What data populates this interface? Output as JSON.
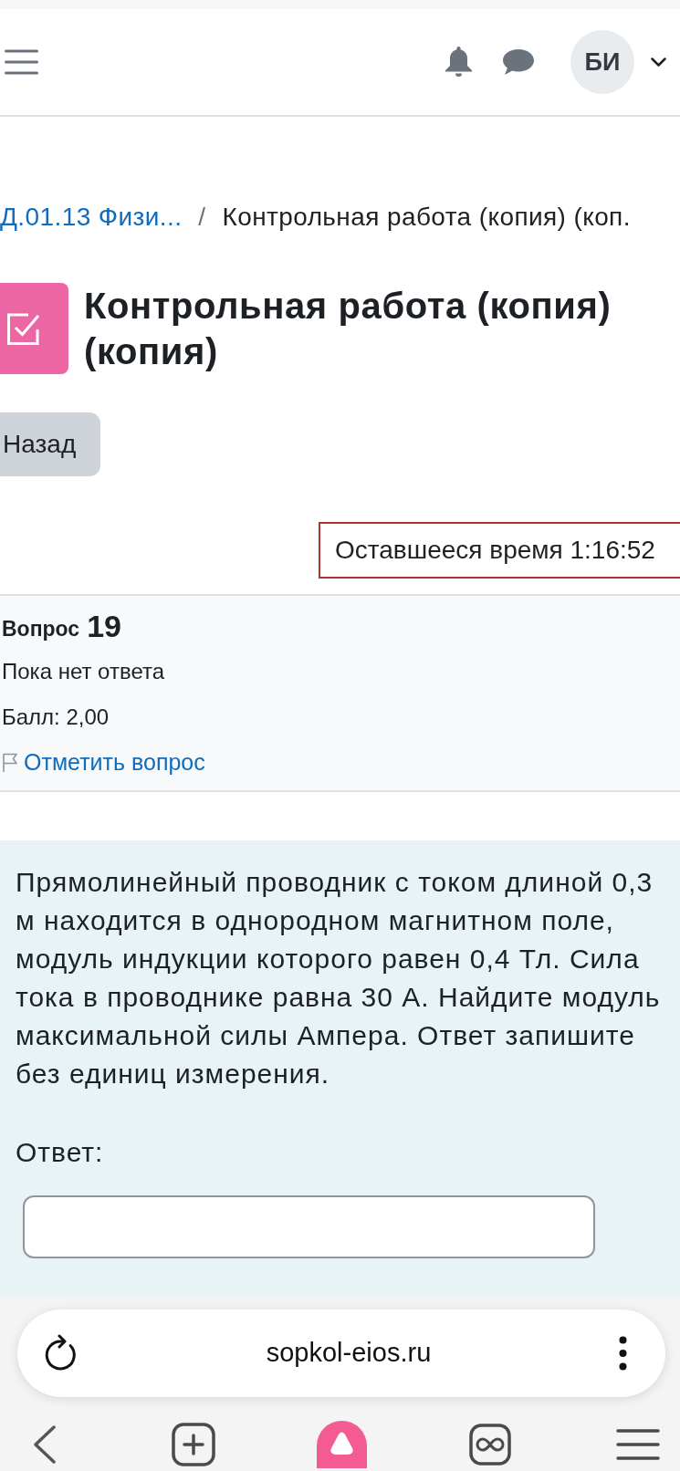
{
  "header": {
    "avatar": "БИ"
  },
  "breadcrumb": {
    "items": [
      {
        "label": "Д.01.13 Физи...",
        "kind": "link"
      },
      {
        "label": "Контрольная работа (копия) (коп.",
        "kind": "current"
      }
    ],
    "separator": "/"
  },
  "page_title": "Контрольная работа (копия) (копия)",
  "back_button": "Назад",
  "timer": "Оставшееся время 1:16:52",
  "question_info": {
    "label": "Вопрос",
    "number": "19",
    "status": "Пока нет ответа",
    "score": "Балл: 2,00",
    "flag_link": {
      "label": "Отметить вопрос",
      "flagged": false
    }
  },
  "question": {
    "text": "Прямолинейный проводник с током длиной 0,3 м находится в однородном магнитном поле, модуль индукции которого равен 0,4 Тл. Сила тока в проводнике равна 30 А. Найдите модуль максимальной силы Ампера. Ответ запишите без единиц измерения.",
    "answer_label": "Ответ:"
  },
  "browser": {
    "url": "sopkol-eios.ru"
  }
}
